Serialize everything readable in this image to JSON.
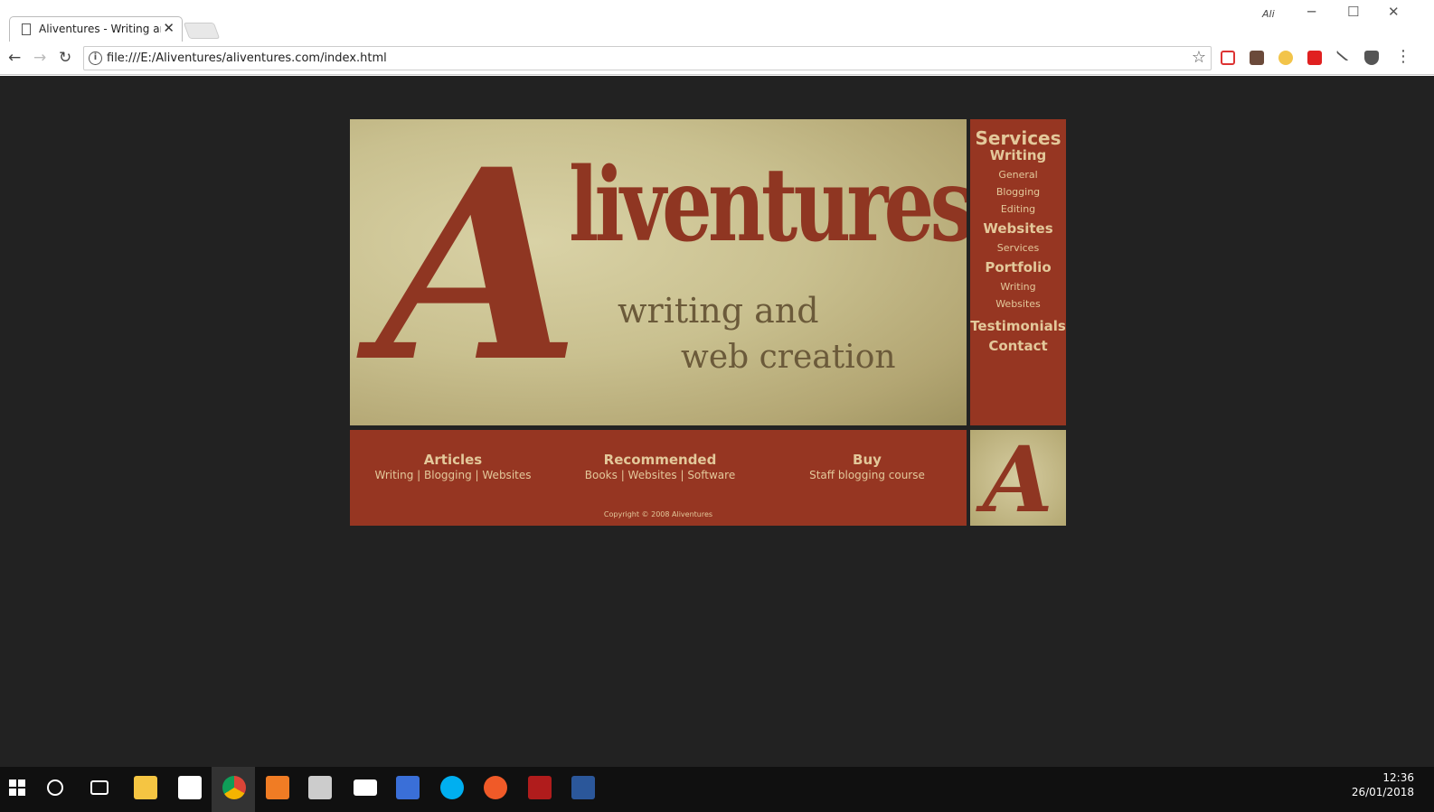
{
  "browser": {
    "tab_title": "Aliventures - Writing and",
    "tab_close": "✕",
    "user": "Ali",
    "url": "file:///E:/Aliventures/aliventures.com/index.html",
    "window_controls": {
      "minimize": "─",
      "maximize": "☐",
      "close": "✕"
    },
    "nav": {
      "back": "←",
      "forward": "→",
      "reload": "↻"
    }
  },
  "site": {
    "logo_initial": "A",
    "logo_rest": "liventures",
    "tagline_line1": "writing and",
    "tagline_line2": "web creation",
    "services": {
      "title": "Services",
      "groups": [
        {
          "heading": "Writing",
          "items": [
            "General",
            "Blogging",
            "Editing"
          ]
        },
        {
          "heading": "Websites",
          "items": [
            "Services"
          ]
        },
        {
          "heading": "Portfolio",
          "items": [
            "Writing",
            "Websites"
          ]
        }
      ],
      "extra": [
        "Testimonials",
        "Contact"
      ]
    },
    "footer": {
      "columns": [
        {
          "title": "Articles",
          "links": "Writing  | Blogging  | Websites"
        },
        {
          "title": "Recommended",
          "links": "Books  | Websites  | Software"
        },
        {
          "title": "Buy",
          "links": "Staff blogging course"
        }
      ],
      "copyright": "Copyright © 2008 Aliventures"
    },
    "thumb_initial": "A"
  },
  "taskbar": {
    "time": "12:36",
    "date": "26/01/2018"
  },
  "colors": {
    "accent": "#963622",
    "link": "#e3c89a",
    "page_bg": "#222222"
  }
}
